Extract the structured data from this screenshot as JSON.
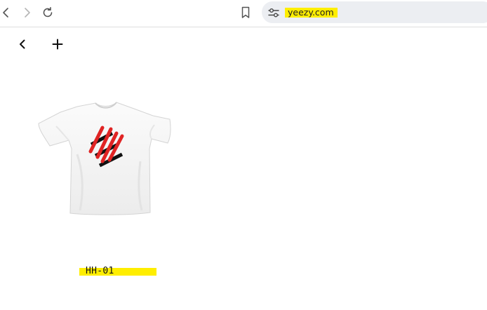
{
  "browser": {
    "url": "yeezy.com"
  },
  "icons": {
    "back": "chevron-left-icon",
    "forward": "chevron-right-icon",
    "reload": "reload-icon",
    "bookmark": "bookmark-icon",
    "site_info": "tune-icon",
    "page_back": "chevron-left-icon",
    "page_add": "plus-icon"
  },
  "products": [
    {
      "name": "HH-01",
      "image": "white-t-shirt-red-black-hash-graphic"
    }
  ],
  "colors": {
    "highlight": "#ffee00",
    "graphic_red": "#e02424",
    "graphic_black": "#111111",
    "omnibox_bg": "#eceef2"
  }
}
